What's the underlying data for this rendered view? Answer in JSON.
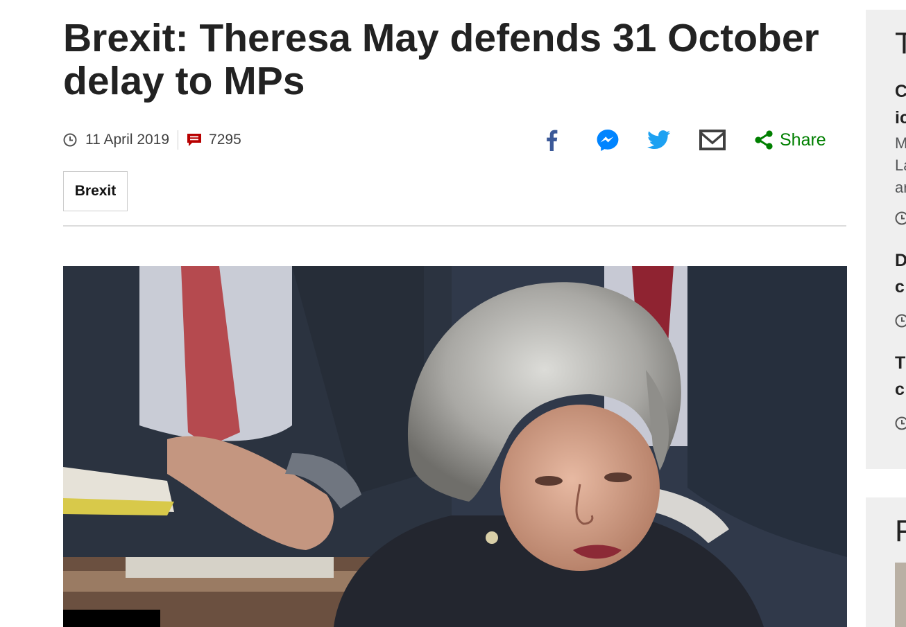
{
  "article": {
    "headline": "Brexit: Theresa May defends 31 October delay to MPs",
    "date": "11 April 2019",
    "comment_count": "7295",
    "tag": "Brexit"
  },
  "share": {
    "label": "Share",
    "icons": [
      "facebook-icon",
      "messenger-icon",
      "twitter-icon",
      "email-icon",
      "share-icon"
    ]
  },
  "colors": {
    "facebook": "#3b5998",
    "messenger": "#0084ff",
    "twitter": "#1da1f2",
    "email": "#404040",
    "share": "#007f00",
    "comments": "#b80000"
  },
  "sidebar": {
    "section_title_initial": "T",
    "items": [
      {
        "title_lines": [
          "C",
          "ic"
        ],
        "summary_lines": [
          "M",
          "La",
          "ar"
        ]
      },
      {
        "title_lines": [
          "D",
          "c"
        ]
      },
      {
        "title_lines": [
          "T",
          "c"
        ]
      }
    ],
    "section2_title_initial": "F"
  }
}
